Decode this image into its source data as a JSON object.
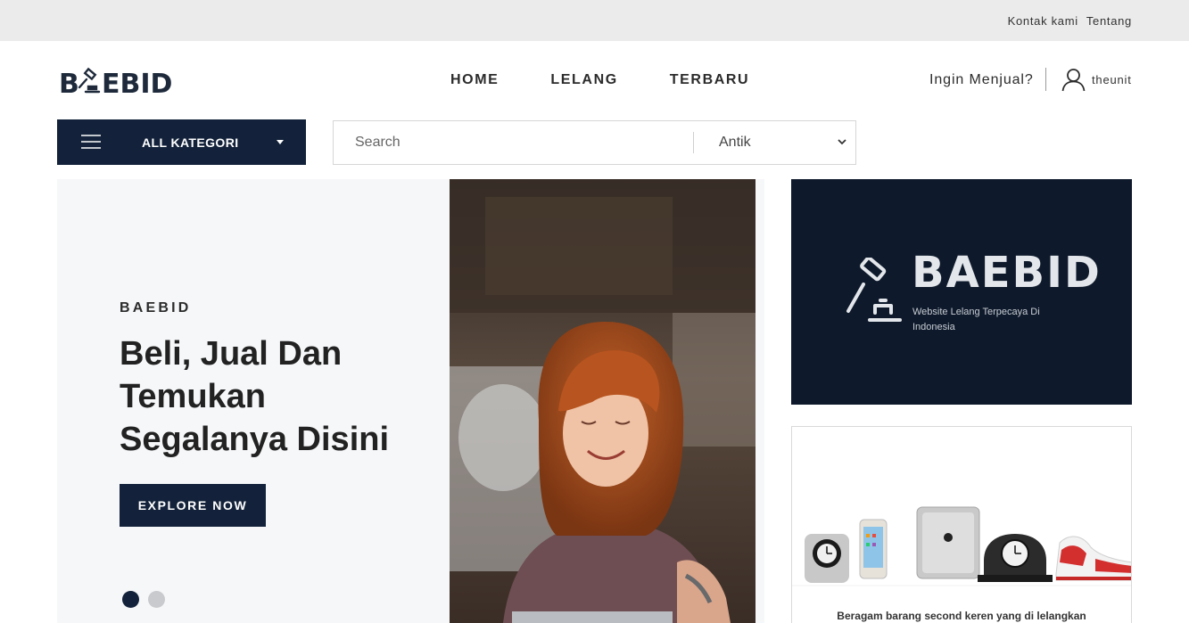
{
  "topbar": {
    "links": [
      "Kontak kami",
      "Tentang"
    ]
  },
  "header": {
    "logo": "BAEBID",
    "nav": [
      "HOME",
      "LELANG",
      "TERBARU"
    ],
    "sell_link": "Ingin Menjual?",
    "username": "theunit"
  },
  "toolbar": {
    "category_label": "ALL KATEGORI",
    "search_placeholder": "Search",
    "selected_category": "Antik"
  },
  "hero": {
    "kicker": "BAEBID",
    "title": "Beli, Jual Dan Temukan Segalanya Disini",
    "button_label": "EXPLORE NOW",
    "slides_total": 2,
    "active_slide": 1
  },
  "banners": {
    "dark": {
      "title": "BAEBID",
      "tagline": "Website Lelang Terpecaya Di Indonesia"
    },
    "light": {
      "caption": "Beragam barang second keren yang di lelangkan"
    }
  },
  "colors": {
    "brand_navy": "#13223a",
    "banner_dark": "#0e1a2c",
    "hero_bg": "#f6f7f9",
    "topbar_bg": "#ebebeb"
  }
}
